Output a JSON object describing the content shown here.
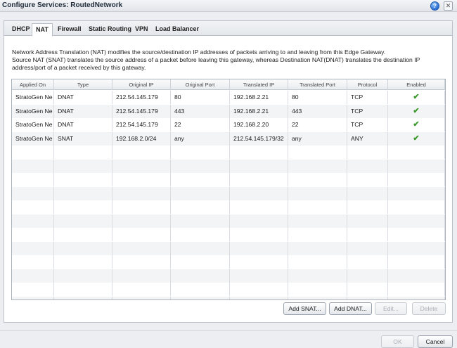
{
  "window": {
    "title": "Configure Services: RoutedNetwork",
    "help_label": "?",
    "close_label": "✕"
  },
  "tabs": [
    {
      "label": "DHCP",
      "active": false
    },
    {
      "label": "NAT",
      "active": true
    },
    {
      "label": "Firewall",
      "active": false
    },
    {
      "label": "Static Routing",
      "active": false
    },
    {
      "label": "VPN",
      "active": false
    },
    {
      "label": "Load Balancer",
      "active": false
    }
  ],
  "description": {
    "line1": "Network Address Translation (NAT) modifies the source/destination IP addresses of packets arriving to and leaving from this Edge Gateway.",
    "line2": "Source NAT (SNAT) translates the source address of a packet before leaving this gateway, whereas Destination NAT(DNAT)  translates the destination IP",
    "line3": "address/port of a packet received by this gateway."
  },
  "table": {
    "columns": [
      "Applied On",
      "Type",
      "Original IP",
      "Original Port",
      "Translated IP",
      "Translated Port",
      "Protocol",
      "Enabled"
    ],
    "rows": [
      {
        "applied_on": "StratoGen Ne",
        "type": "DNAT",
        "original_ip": "212.54.145.179",
        "original_port": "80",
        "translated_ip": "192.168.2.21",
        "translated_port": "80",
        "protocol": "TCP",
        "enabled": "✔"
      },
      {
        "applied_on": "StratoGen Ne",
        "type": "DNAT",
        "original_ip": "212.54.145.179",
        "original_port": "443",
        "translated_ip": "192.168.2.21",
        "translated_port": "443",
        "protocol": "TCP",
        "enabled": "✔"
      },
      {
        "applied_on": "StratoGen Ne",
        "type": "DNAT",
        "original_ip": "212.54.145.179",
        "original_port": "22",
        "translated_ip": "192.168.2.20",
        "translated_port": "22",
        "protocol": "TCP",
        "enabled": "✔"
      },
      {
        "applied_on": "StratoGen Ne",
        "type": "SNAT",
        "original_ip": "192.168.2.0/24",
        "original_port": "any",
        "translated_ip": "212.54.145.179/32",
        "translated_port": "any",
        "protocol": "ANY",
        "enabled": "✔"
      }
    ],
    "empty_row_count": 12
  },
  "actions": {
    "add_snat": "Add SNAT...",
    "add_dnat": "Add DNAT...",
    "edit": "Edit...",
    "delete": "Delete"
  },
  "footer": {
    "ok": "OK",
    "cancel": "Cancel"
  },
  "colors": {
    "enabled_check": "#3a9a2a",
    "help_icon": "#2c6fd1"
  }
}
